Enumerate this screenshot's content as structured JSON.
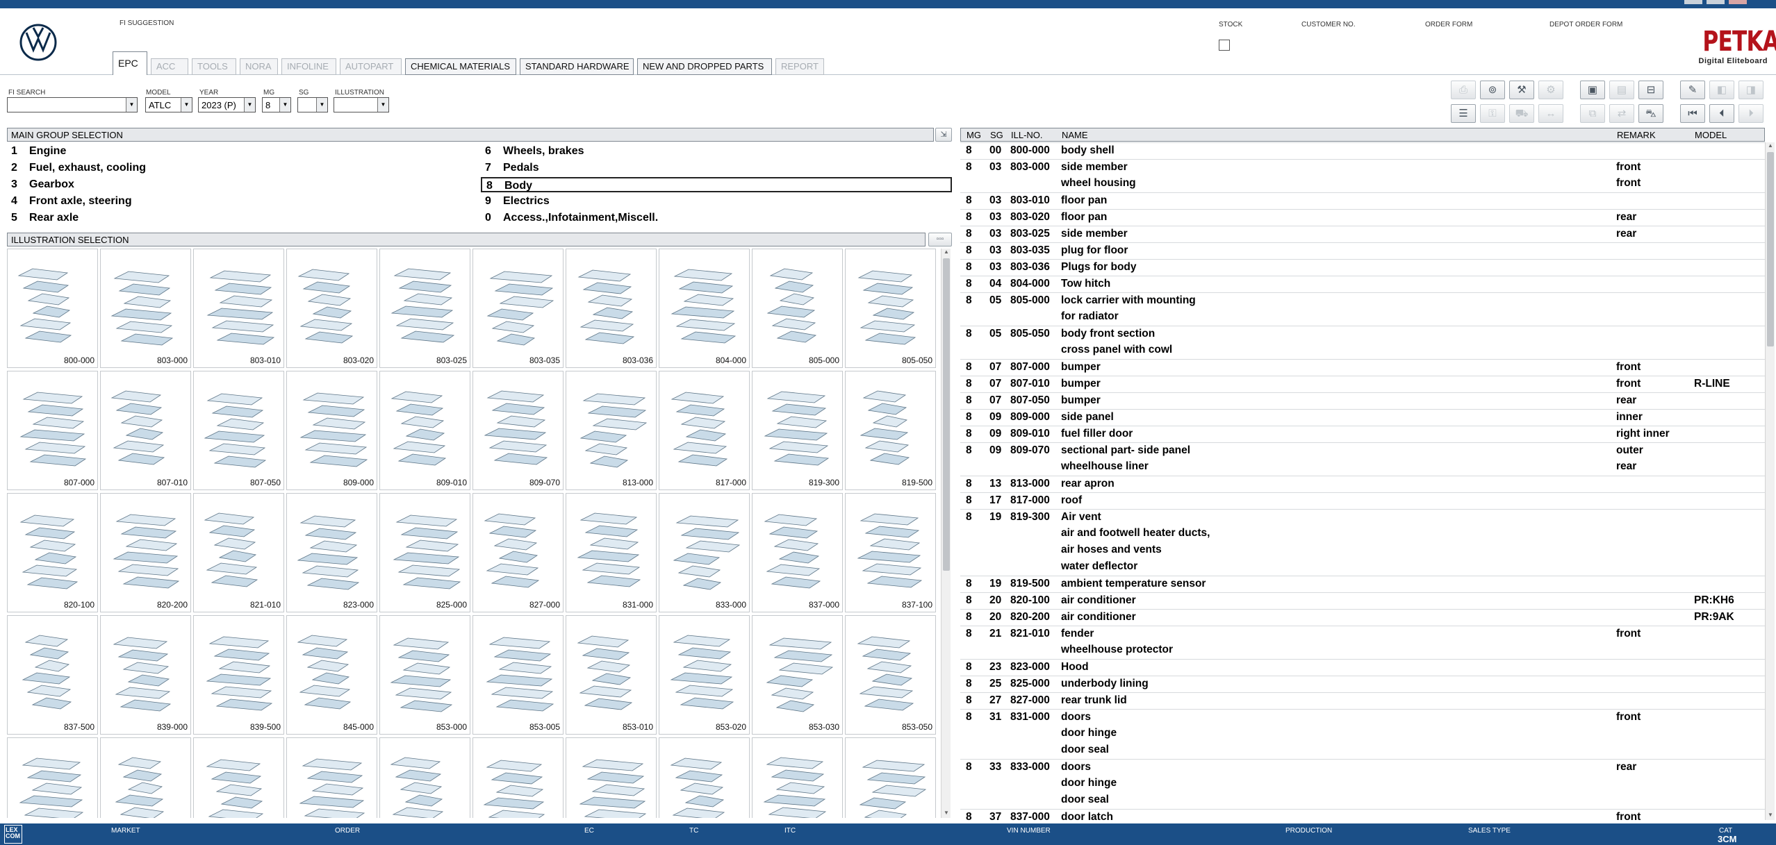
{
  "header": {
    "fi_suggestion": "FI SUGGESTION",
    "stock": "STOCK",
    "customer_no": "CUSTOMER NO.",
    "order_form": "ORDER FORM",
    "depot_order_form": "DEPOT ORDER FORM",
    "brand": "PETKA",
    "brand_sub": "Digital Eliteboard"
  },
  "tabs": [
    "EPC",
    "ACC",
    "TOOLS",
    "NORA",
    "INFOLINE",
    "AUTOPART",
    "CHEMICAL MATERIALS",
    "STANDARD HARDWARE",
    "NEW AND DROPPED PARTS",
    "REPORT"
  ],
  "tab_states": {
    "active": "EPC",
    "disabled": [
      "ACC",
      "TOOLS",
      "NORA",
      "INFOLINE",
      "AUTOPART",
      "REPORT"
    ]
  },
  "filters": {
    "fi_search": {
      "label": "FI SEARCH",
      "value": ""
    },
    "model": {
      "label": "MODEL",
      "value": "ATLC"
    },
    "year": {
      "label": "YEAR",
      "value": "2023 (P)"
    },
    "mg": {
      "label": "MG",
      "value": "8"
    },
    "sg": {
      "label": "SG",
      "value": ""
    },
    "illustration": {
      "label": "ILLUSTRATION",
      "value": ""
    }
  },
  "main_group": {
    "title": "MAIN GROUP SELECTION",
    "selected": "8",
    "items": [
      {
        "no": "1",
        "name": "Engine"
      },
      {
        "no": "2",
        "name": "Fuel, exhaust, cooling"
      },
      {
        "no": "3",
        "name": "Gearbox"
      },
      {
        "no": "4",
        "name": "Front axle, steering"
      },
      {
        "no": "5",
        "name": "Rear axle"
      },
      {
        "no": "6",
        "name": "Wheels, brakes"
      },
      {
        "no": "7",
        "name": "Pedals"
      },
      {
        "no": "8",
        "name": "Body"
      },
      {
        "no": "9",
        "name": "Electrics"
      },
      {
        "no": "0",
        "name": "Access.,Infotainment,Miscell."
      }
    ]
  },
  "illustration": {
    "title": "ILLUSTRATION SELECTION",
    "thumbs": [
      "800-000",
      "803-000",
      "803-010",
      "803-020",
      "803-025",
      "803-035",
      "803-036",
      "804-000",
      "805-000",
      "805-050",
      "807-000",
      "807-010",
      "807-050",
      "809-000",
      "809-010",
      "809-070",
      "813-000",
      "817-000",
      "819-300",
      "819-500",
      "820-100",
      "820-200",
      "821-010",
      "823-000",
      "825-000",
      "827-000",
      "831-000",
      "833-000",
      "837-000",
      "837-100",
      "837-500",
      "839-000",
      "839-500",
      "845-000",
      "853-000",
      "853-005",
      "853-010",
      "853-020",
      "853-030",
      "853-050",
      "",
      "",
      "",
      "",
      "",
      "",
      "",
      "",
      "",
      ""
    ]
  },
  "parts_table": {
    "columns": {
      "mg": "MG",
      "sg": "SG",
      "ill": "ILL-NO.",
      "name": "NAME",
      "remark": "REMARK",
      "model": "MODEL"
    },
    "rows": [
      {
        "mg": "8",
        "sg": "00",
        "ill": "800-000",
        "name": "body shell",
        "remark": "",
        "model": ""
      },
      {
        "mg": "8",
        "sg": "03",
        "ill": "803-000",
        "name": "side member",
        "remark": "front",
        "model": ""
      },
      {
        "mg": "",
        "sg": "",
        "ill": "",
        "name": "wheel housing",
        "remark": "front",
        "model": ""
      },
      {
        "mg": "8",
        "sg": "03",
        "ill": "803-010",
        "name": "floor pan",
        "remark": "",
        "model": ""
      },
      {
        "mg": "8",
        "sg": "03",
        "ill": "803-020",
        "name": "floor pan",
        "remark": "rear",
        "model": ""
      },
      {
        "mg": "8",
        "sg": "03",
        "ill": "803-025",
        "name": "side member",
        "remark": "rear",
        "model": ""
      },
      {
        "mg": "8",
        "sg": "03",
        "ill": "803-035",
        "name": "plug for floor",
        "remark": "",
        "model": ""
      },
      {
        "mg": "8",
        "sg": "03",
        "ill": "803-036",
        "name": "Plugs for body",
        "remark": "",
        "model": ""
      },
      {
        "mg": "8",
        "sg": "04",
        "ill": "804-000",
        "name": "Tow hitch",
        "remark": "",
        "model": ""
      },
      {
        "mg": "8",
        "sg": "05",
        "ill": "805-000",
        "name": "lock carrier with mounting",
        "remark": "",
        "model": ""
      },
      {
        "mg": "",
        "sg": "",
        "ill": "",
        "name": "for radiator",
        "remark": "",
        "model": ""
      },
      {
        "mg": "8",
        "sg": "05",
        "ill": "805-050",
        "name": "body front section",
        "remark": "",
        "model": ""
      },
      {
        "mg": "",
        "sg": "",
        "ill": "",
        "name": "cross panel with cowl",
        "remark": "",
        "model": ""
      },
      {
        "mg": "8",
        "sg": "07",
        "ill": "807-000",
        "name": "bumper",
        "remark": "front",
        "model": ""
      },
      {
        "mg": "8",
        "sg": "07",
        "ill": "807-010",
        "name": "bumper",
        "remark": "front",
        "model": "R-LINE"
      },
      {
        "mg": "8",
        "sg": "07",
        "ill": "807-050",
        "name": "bumper",
        "remark": "rear",
        "model": ""
      },
      {
        "mg": "8",
        "sg": "09",
        "ill": "809-000",
        "name": "side panel",
        "remark": "inner",
        "model": ""
      },
      {
        "mg": "8",
        "sg": "09",
        "ill": "809-010",
        "name": "fuel filler door",
        "remark": "right inner",
        "model": ""
      },
      {
        "mg": "8",
        "sg": "09",
        "ill": "809-070",
        "name": "sectional part- side panel",
        "remark": "outer",
        "model": ""
      },
      {
        "mg": "",
        "sg": "",
        "ill": "",
        "name": "wheelhouse liner",
        "remark": "rear",
        "model": ""
      },
      {
        "mg": "8",
        "sg": "13",
        "ill": "813-000",
        "name": "rear apron",
        "remark": "",
        "model": ""
      },
      {
        "mg": "8",
        "sg": "17",
        "ill": "817-000",
        "name": "roof",
        "remark": "",
        "model": ""
      },
      {
        "mg": "8",
        "sg": "19",
        "ill": "819-300",
        "name": "Air vent",
        "remark": "",
        "model": ""
      },
      {
        "mg": "",
        "sg": "",
        "ill": "",
        "name": "air and footwell heater ducts,",
        "remark": "",
        "model": ""
      },
      {
        "mg": "",
        "sg": "",
        "ill": "",
        "name": "air hoses and vents",
        "remark": "",
        "model": ""
      },
      {
        "mg": "",
        "sg": "",
        "ill": "",
        "name": "water deflector",
        "remark": "",
        "model": ""
      },
      {
        "mg": "8",
        "sg": "19",
        "ill": "819-500",
        "name": "ambient temperature sensor",
        "remark": "",
        "model": ""
      },
      {
        "mg": "8",
        "sg": "20",
        "ill": "820-100",
        "name": "air conditioner",
        "remark": "",
        "model": "PR:KH6"
      },
      {
        "mg": "8",
        "sg": "20",
        "ill": "820-200",
        "name": "air conditioner",
        "remark": "",
        "model": "PR:9AK"
      },
      {
        "mg": "8",
        "sg": "21",
        "ill": "821-010",
        "name": "fender",
        "remark": "front",
        "model": ""
      },
      {
        "mg": "",
        "sg": "",
        "ill": "",
        "name": "wheelhouse protector",
        "remark": "",
        "model": ""
      },
      {
        "mg": "8",
        "sg": "23",
        "ill": "823-000",
        "name": "Hood",
        "remark": "",
        "model": ""
      },
      {
        "mg": "8",
        "sg": "25",
        "ill": "825-000",
        "name": "underbody lining",
        "remark": "",
        "model": ""
      },
      {
        "mg": "8",
        "sg": "27",
        "ill": "827-000",
        "name": "rear trunk lid",
        "remark": "",
        "model": ""
      },
      {
        "mg": "8",
        "sg": "31",
        "ill": "831-000",
        "name": "doors",
        "remark": "front",
        "model": ""
      },
      {
        "mg": "",
        "sg": "",
        "ill": "",
        "name": "door hinge",
        "remark": "",
        "model": ""
      },
      {
        "mg": "",
        "sg": "",
        "ill": "",
        "name": "door seal",
        "remark": "",
        "model": ""
      },
      {
        "mg": "8",
        "sg": "33",
        "ill": "833-000",
        "name": "doors",
        "remark": "rear",
        "model": ""
      },
      {
        "mg": "",
        "sg": "",
        "ill": "",
        "name": "door hinge",
        "remark": "",
        "model": ""
      },
      {
        "mg": "",
        "sg": "",
        "ill": "",
        "name": "door seal",
        "remark": "",
        "model": ""
      },
      {
        "mg": "8",
        "sg": "37",
        "ill": "837-000",
        "name": "door latch",
        "remark": "front",
        "model": ""
      }
    ]
  },
  "statusbar": {
    "logo": "LEX COM",
    "market": "MARKET",
    "order": "ORDER",
    "ec": "EC",
    "tc": "TC",
    "itc": "ITC",
    "vin": "VIN NUMBER",
    "production": "PRODUCTION",
    "sales_type": "SALES TYPE",
    "cat": "CAT",
    "cat_value": "3CM"
  },
  "colors": {
    "accent": "#1b4f87",
    "brand": "#b4131b",
    "selected_border": "#222222"
  }
}
